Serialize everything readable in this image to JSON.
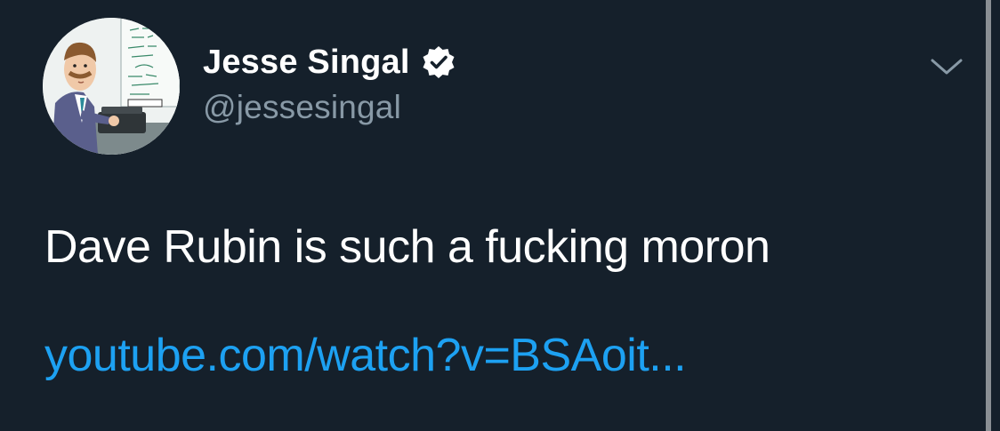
{
  "tweet": {
    "author": {
      "display_name": "Jesse Singal",
      "handle": "@jessesingal",
      "verified": true,
      "avatar_icon": "cartoon-man-at-typewriter-avatar"
    },
    "text": "Dave Rubin is such a fucking moron",
    "link_text": "youtube.com/watch?v=BSAoit...",
    "menu_icon": "chevron-down-icon"
  },
  "colors": {
    "background": "#15202b",
    "text": "#ffffff",
    "secondary_text": "#8899a6",
    "link": "#1da1f2",
    "verified_badge": "#ffffff"
  }
}
